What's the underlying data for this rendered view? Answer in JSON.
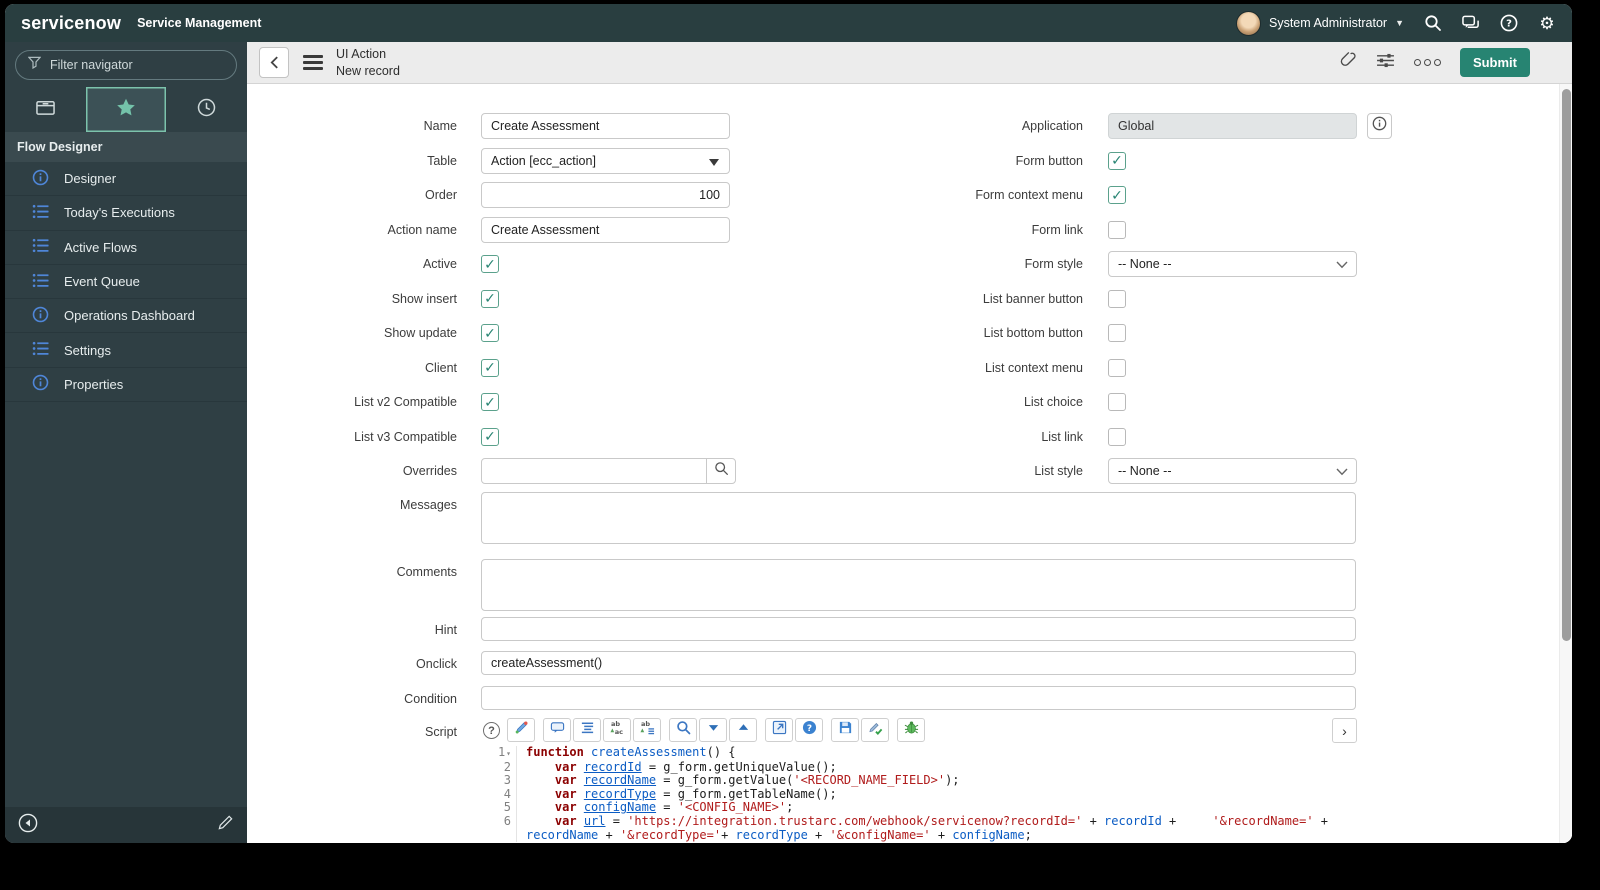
{
  "colors": {
    "header_bg": "#293e40",
    "accent_teal": "#7cc3ac",
    "nav_icon_blue": "#4f86d8",
    "submit_green": "#278472",
    "check_green": "#278472",
    "code_keyword": "#8b0000",
    "code_string": "#b01b1b",
    "code_variable": "#0b5cc4"
  },
  "top_header": {
    "brand": "servicenow",
    "product": "Service Management",
    "user": "System Administrator",
    "icons": [
      "search-icon",
      "chat-icon",
      "help-icon",
      "gear-icon"
    ]
  },
  "sidebar": {
    "filter_placeholder": "Filter navigator",
    "tabs": [
      {
        "name": "all-applications",
        "icon": "box-icon",
        "active": false
      },
      {
        "name": "favorites",
        "icon": "star-icon",
        "active": true
      },
      {
        "name": "history",
        "icon": "clock-icon",
        "active": false
      }
    ],
    "section_title": "Flow Designer",
    "items": [
      {
        "label": "Designer",
        "icon": "info-circle-icon"
      },
      {
        "label": "Today's Executions",
        "icon": "list-icon"
      },
      {
        "label": "Active Flows",
        "icon": "list-icon"
      },
      {
        "label": "Event Queue",
        "icon": "list-icon"
      },
      {
        "label": "Operations Dashboard",
        "icon": "info-circle-icon"
      },
      {
        "label": "Settings",
        "icon": "list-icon"
      },
      {
        "label": "Properties",
        "icon": "info-circle-icon"
      }
    ],
    "bottom_icons": [
      "collapse-icon",
      "pencil-icon"
    ]
  },
  "form_header": {
    "title": "UI Action",
    "subtitle": "New record",
    "icons": [
      "attachment-icon",
      "personalize-icon",
      "more-options-icon"
    ],
    "submit_label": "Submit"
  },
  "form": {
    "left": [
      {
        "label": "Name",
        "type": "text",
        "value": "Create Assessment"
      },
      {
        "label": "Table",
        "type": "select-solid",
        "value": "Action [ecc_action]"
      },
      {
        "label": "Order",
        "type": "number",
        "value": "100"
      },
      {
        "label": "Action name",
        "type": "text",
        "value": "Create Assessment"
      },
      {
        "label": "Active",
        "type": "checkbox",
        "value": "checked"
      },
      {
        "label": "Show insert",
        "type": "checkbox",
        "value": "checked"
      },
      {
        "label": "Show update",
        "type": "checkbox",
        "value": "checked"
      },
      {
        "label": "Client",
        "type": "checkbox",
        "value": "checked"
      },
      {
        "label": "List v2 Compatible",
        "type": "checkbox",
        "value": "checked"
      },
      {
        "label": "List v3 Compatible",
        "type": "checkbox",
        "value": "checked"
      },
      {
        "label": "Overrides",
        "type": "reference",
        "value": ""
      }
    ],
    "wide": [
      {
        "label": "Messages",
        "type": "textarea",
        "value": ""
      },
      {
        "label": "Comments",
        "type": "textarea",
        "value": ""
      },
      {
        "label": "Hint",
        "type": "text",
        "value": ""
      },
      {
        "label": "Onclick",
        "type": "text",
        "value": "createAssessment()"
      },
      {
        "label": "Condition",
        "type": "text",
        "value": ""
      }
    ],
    "right": [
      {
        "label": "Application",
        "type": "readonly",
        "value": "Global",
        "info": true
      },
      {
        "label": "Form button",
        "type": "checkbox",
        "value": "checked"
      },
      {
        "label": "Form context menu",
        "type": "checkbox",
        "value": "checked"
      },
      {
        "label": "Form link",
        "type": "checkbox",
        "value": "unchecked"
      },
      {
        "label": "Form style",
        "type": "select",
        "value": "-- None --"
      },
      {
        "label": "List banner button",
        "type": "checkbox",
        "value": "unchecked"
      },
      {
        "label": "List bottom button",
        "type": "checkbox",
        "value": "unchecked"
      },
      {
        "label": "List context menu",
        "type": "checkbox",
        "value": "unchecked"
      },
      {
        "label": "List choice",
        "type": "checkbox",
        "value": "unchecked"
      },
      {
        "label": "List link",
        "type": "checkbox",
        "value": "unchecked"
      },
      {
        "label": "List style",
        "type": "select",
        "value": "-- None --"
      }
    ],
    "script_label": "Script"
  },
  "script_editor": {
    "toolbar_groups": [
      [
        "syntax-editor-icon"
      ],
      [
        "comment-icon",
        "format-code-icon",
        "replace-icon",
        "replace-all-icon"
      ],
      [
        "search-icon",
        "find-next-icon",
        "find-previous-icon"
      ],
      [
        "open-window-icon",
        "api-help-icon"
      ],
      [
        "save-icon",
        "validate-icon"
      ],
      [
        "debug-icon"
      ]
    ],
    "expand_label": "›",
    "help_label": "?",
    "lines": [
      {
        "num": "1",
        "fold": true,
        "tokens": [
          {
            "t": "function ",
            "c": "kw"
          },
          {
            "t": "createAssessment",
            "c": "fn"
          },
          {
            "t": "() {",
            "c": "pl"
          }
        ]
      },
      {
        "num": "2",
        "tokens": [
          {
            "t": "    ",
            "c": "pl"
          },
          {
            "t": "var ",
            "c": "kw"
          },
          {
            "t": "recordId",
            "c": "def"
          },
          {
            "t": " = g_form.getUniqueValue();",
            "c": "pl"
          }
        ]
      },
      {
        "num": "3",
        "tokens": [
          {
            "t": "    ",
            "c": "pl"
          },
          {
            "t": "var ",
            "c": "kw"
          },
          {
            "t": "recordName",
            "c": "def"
          },
          {
            "t": " = g_form.getValue(",
            "c": "pl"
          },
          {
            "t": "'<RECORD_NAME_FIELD>'",
            "c": "str"
          },
          {
            "t": ");",
            "c": "pl"
          }
        ]
      },
      {
        "num": "4",
        "tokens": [
          {
            "t": "    ",
            "c": "pl"
          },
          {
            "t": "var ",
            "c": "kw"
          },
          {
            "t": "recordType",
            "c": "def"
          },
          {
            "t": " = g_form.getTableName();",
            "c": "pl"
          }
        ]
      },
      {
        "num": "5",
        "tokens": [
          {
            "t": "    ",
            "c": "pl"
          },
          {
            "t": "var ",
            "c": "kw"
          },
          {
            "t": "configName",
            "c": "def"
          },
          {
            "t": " = ",
            "c": "pl"
          },
          {
            "t": "'<CONFIG_NAME>'",
            "c": "str"
          },
          {
            "t": ";",
            "c": "pl"
          }
        ]
      },
      {
        "num": "6",
        "tokens": [
          {
            "t": "    ",
            "c": "pl"
          },
          {
            "t": "var ",
            "c": "kw"
          },
          {
            "t": "url",
            "c": "def"
          },
          {
            "t": " = ",
            "c": "pl"
          },
          {
            "t": "'https://integration.trustarc.com/webhook/servicenow?recordId='",
            "c": "str"
          },
          {
            "t": " + ",
            "c": "pl"
          },
          {
            "t": "recordId",
            "c": "var"
          },
          {
            "t": " +     ",
            "c": "pl"
          },
          {
            "t": "'&recordName='",
            "c": "str"
          },
          {
            "t": " + ",
            "c": "pl"
          },
          {
            "t": "recordName",
            "c": "var"
          },
          {
            "t": " + ",
            "c": "pl"
          },
          {
            "t": "'&recordType='",
            "c": "str"
          },
          {
            "t": "+ ",
            "c": "pl"
          },
          {
            "t": "recordType",
            "c": "var"
          },
          {
            "t": " + ",
            "c": "pl"
          },
          {
            "t": "'&configName='",
            "c": "str"
          },
          {
            "t": " + ",
            "c": "pl"
          },
          {
            "t": "configName",
            "c": "var"
          },
          {
            "t": ";",
            "c": "pl"
          }
        ]
      }
    ]
  }
}
